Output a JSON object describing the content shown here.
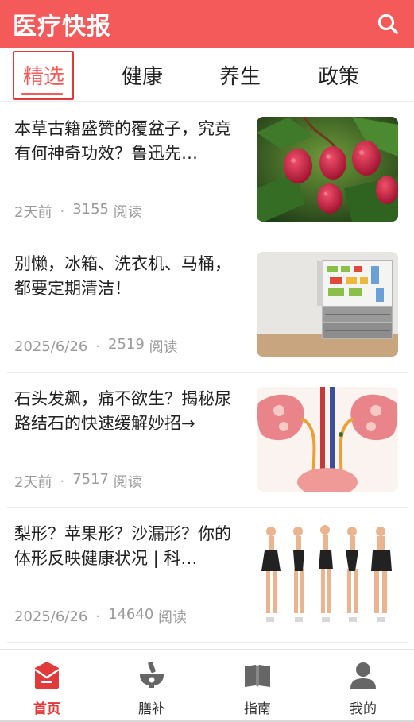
{
  "header": {
    "title": "医疗快报",
    "search_icon": "search-icon"
  },
  "tabs": [
    {
      "label": "精选",
      "active": true
    },
    {
      "label": "健康",
      "active": false
    },
    {
      "label": "养生",
      "active": false
    },
    {
      "label": "政策",
      "active": false
    }
  ],
  "articles": [
    {
      "title": "本草古籍盛赞的覆盆子，究竟有何神奇功效？鲁迅先…",
      "date": "2天前",
      "reads": "3155",
      "reads_unit": "阅读",
      "thumb": "raspberry-image"
    },
    {
      "title": "别懒，冰箱、洗衣机、马桶，都要定期清洁！",
      "date": "2025/6/26",
      "reads": "2519",
      "reads_unit": "阅读",
      "thumb": "refrigerator-image"
    },
    {
      "title": "石头发飙，痛不欲生？揭秘尿路结石的快速缓解妙招→",
      "date": "2天前",
      "reads": "7517",
      "reads_unit": "阅读",
      "thumb": "urinary-tract-image"
    },
    {
      "title": "梨形？苹果形？沙漏形？你的体形反映健康状况 | 科…",
      "date": "2025/6/26",
      "reads": "14640",
      "reads_unit": "阅读",
      "thumb": "body-shapes-image"
    }
  ],
  "bottom_nav": [
    {
      "label": "首页",
      "icon": "home-icon",
      "active": true
    },
    {
      "label": "膳补",
      "icon": "mortar-icon",
      "active": false
    },
    {
      "label": "指南",
      "icon": "book-icon",
      "active": false
    },
    {
      "label": "我的",
      "icon": "user-icon",
      "active": false
    }
  ],
  "colors": {
    "brand": "#f45a5a",
    "active_text": "#e23a3a",
    "meta": "#9a9a9a"
  }
}
